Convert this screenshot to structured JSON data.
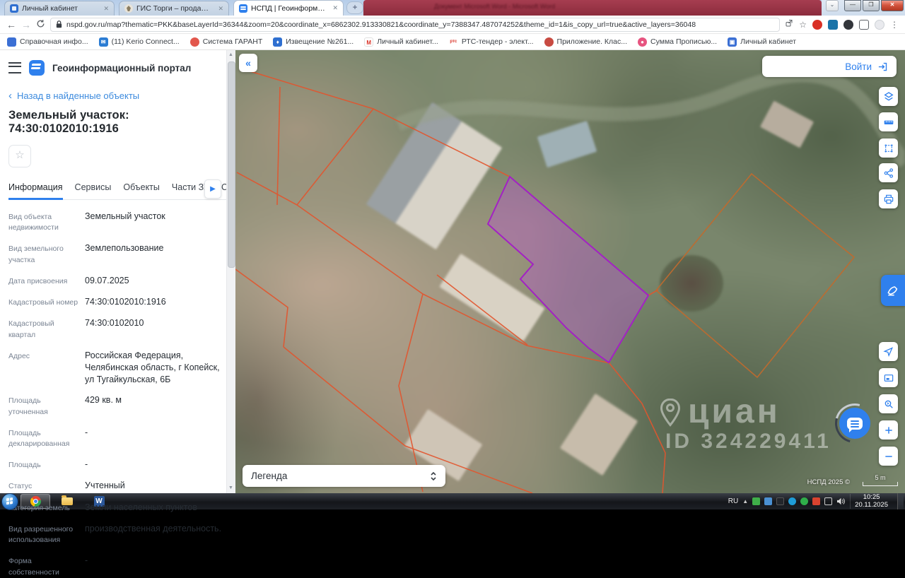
{
  "browser": {
    "tabs": [
      {
        "title": "Личный кабинет"
      },
      {
        "title": "ГИС Торги – продажи государс"
      },
      {
        "title": "НСПД | Геоинформационный п"
      }
    ],
    "new_tab_label": "+",
    "url": "nspd.gov.ru/map?thematic=PKK&baseLayerId=36344&zoom=20&coordinate_x=6862302.913330821&coordinate_y=7388347.487074252&theme_id=1&is_copy_url=true&active_layers=36048",
    "bookmarks": [
      {
        "label": "Справочная инфо..."
      },
      {
        "label": "(11) Kerio Connect..."
      },
      {
        "label": "Система ГАРАНТ"
      },
      {
        "label": "Извещение №261..."
      },
      {
        "label": "Личный кабинет..."
      },
      {
        "label": "РТС-тендер - элект..."
      },
      {
        "label": "Приложение. Клас..."
      },
      {
        "label": "Сумма Прописью..."
      },
      {
        "label": "Личный кабинет"
      }
    ]
  },
  "word_window": {
    "title": "Документ Microsoft Word - Microsoft Word"
  },
  "portal": {
    "app_title": "Геоинформационный портал",
    "back_link": "Назад в найденные объекты",
    "object_title": "Земельный участок: 74:30:0102010:1916",
    "login_label": "Войти",
    "tabs": [
      {
        "label": "Информация"
      },
      {
        "label": "Сервисы"
      },
      {
        "label": "Объекты"
      },
      {
        "label": "Части ЗУ"
      },
      {
        "label": "Соста"
      }
    ],
    "fields": [
      {
        "label": "Вид объекта недвижимости",
        "value": "Земельный участок"
      },
      {
        "label": "Вид земельного участка",
        "value": "Землепользование"
      },
      {
        "label": "Дата присвоения",
        "value": "09.07.2025"
      },
      {
        "label": "Кадастровый номер",
        "value": "74:30:0102010:1916"
      },
      {
        "label": "Кадастровый квартал",
        "value": "74:30:0102010"
      },
      {
        "label": "Адрес",
        "value": "Российская Федерация, Челябинская область, г Копейск, ул Тугайкульская, 6Б"
      },
      {
        "label": "Площадь уточненная",
        "value": "429 кв. м"
      },
      {
        "label": "Площадь декларированная",
        "value": "-"
      },
      {
        "label": "Площадь",
        "value": "-"
      },
      {
        "label": "Статус",
        "value": "Учтенный"
      },
      {
        "label": "Категория земель",
        "value": "Земли населенных пунктов"
      },
      {
        "label": "Вид разрешенного использования",
        "value": "производственная деятельность."
      },
      {
        "label": "Форма собственности",
        "value": "-"
      }
    ]
  },
  "map": {
    "legend_label": "Легенда",
    "attribution": "НСПД 2025 ©",
    "scale_label": "5 m",
    "watermark": {
      "brand": "циан",
      "id": "ID 324229411"
    },
    "parcel_color": "#a321c4",
    "boundary_color": "#e2552e"
  },
  "taskbar": {
    "lang": "RU",
    "time": "10:25",
    "date": "20.11.2025"
  }
}
